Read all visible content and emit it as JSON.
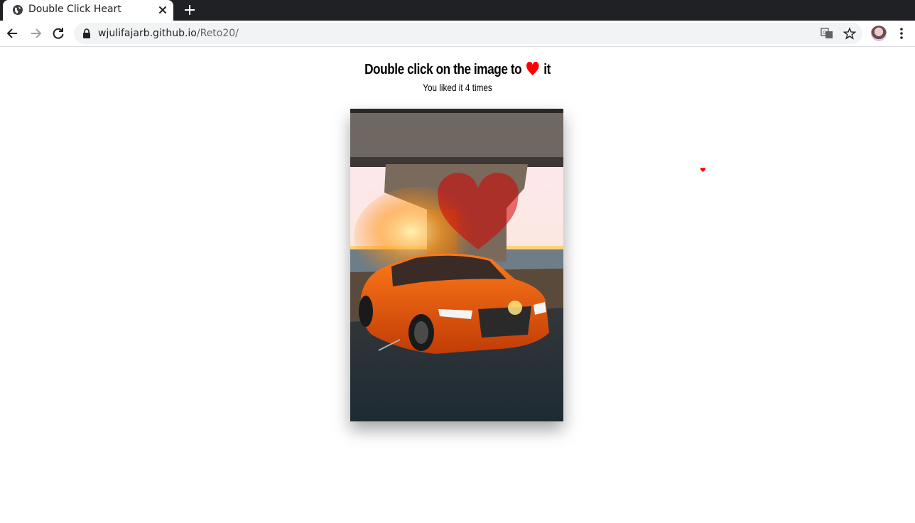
{
  "browser": {
    "tab": {
      "title": "Double Click Heart"
    },
    "address": {
      "host": "wjulifajarb.github.io",
      "path": "/Reto20/"
    }
  },
  "page": {
    "headline_before": "Double click on the image to",
    "headline_after": "it",
    "likes_text": "You liked it 4 times",
    "likes_count": 4,
    "icons": {
      "headline_heart": "heart-icon",
      "photo_heart": "heart-icon",
      "floating_heart": "heart-icon"
    }
  },
  "colors": {
    "heart": "#ff0000",
    "tabstrip": "#202124",
    "omnibox": "#f1f3f4"
  }
}
